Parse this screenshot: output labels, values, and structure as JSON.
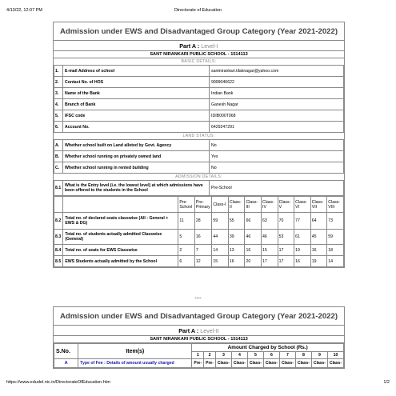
{
  "browser": {
    "datetime": "4/13/22, 12:07 PM",
    "page_title": "Directorate of Education",
    "url": "https://www.edudel.nic.in/DirectorateOfEducation.htm",
    "page_num": "1/2"
  },
  "form1": {
    "title": "Admission under EWS and Disadvantaged Group Category (Year 2021-2022)",
    "part": "Part A :",
    "level": "Level-I",
    "school": "SANT NIRANKARI PUBLIC SCHOOL - 1514113",
    "basic_heading": "BASIC DETAILS:",
    "basic": [
      {
        "n": "1.",
        "q": "E-mail Address of school",
        "v": "santnirankari.tilaknagar@yahoo.com"
      },
      {
        "n": "2.",
        "q": "Contact No. of HOS",
        "v": "9999046622"
      },
      {
        "n": "3.",
        "q": "Name of the Bank",
        "v": "Indian Bank"
      },
      {
        "n": "4.",
        "q": "Branch of Bank",
        "v": "Ganesh Nagar"
      },
      {
        "n": "5.",
        "q": "IFSC code",
        "v": "IDIB000T068"
      },
      {
        "n": "6.",
        "q": "Account No.",
        "v": "6429247291"
      }
    ],
    "land_heading": "LAND STATUS:",
    "land": [
      {
        "n": "A.",
        "q": "Whether school built on Land alloted by Govt. Agency",
        "v": "No"
      },
      {
        "n": "B.",
        "q": "Whether school running on privately owned land",
        "v": "Yes"
      },
      {
        "n": "C.",
        "q": "Whether school running in rented building",
        "v": "No"
      }
    ],
    "adm_heading": "ADMISSION DETAILS:",
    "adm_81": {
      "n": "8.1",
      "q": "What is the Entry level (i.e. the lowest level) at which admissions have been offered to the students in the School",
      "v": "Pre-School"
    },
    "classes": [
      "Pre-School",
      "Pre-Primary",
      "Class-I",
      "Class-II",
      "Class-III",
      "Class-IV",
      "Class-V",
      "Class-VI",
      "Class-VII",
      "Class-VIII"
    ],
    "rows": [
      {
        "n": "8.2",
        "q": "Total no. of declared seats classwise (All : General + EWS & DG)",
        "vals": [
          "11",
          "28",
          "59",
          "55",
          "66",
          "63",
          "70",
          "77",
          "64",
          "73"
        ]
      },
      {
        "n": "8.3",
        "q": "Total no. of students actually admitted Classwise (General)",
        "vals": [
          "5",
          "16",
          "44",
          "39",
          "46",
          "46",
          "53",
          "61",
          "45",
          "59"
        ]
      },
      {
        "n": "8.4",
        "q": "Total no. of seats for EWS Classwise",
        "vals": [
          "2",
          "7",
          "14",
          "13",
          "16",
          "15",
          "17",
          "19",
          "16",
          "18"
        ]
      },
      {
        "n": "8.5",
        "q": "EWS Students actually admitted by the School",
        "vals": [
          "6",
          "12",
          "15",
          "16",
          "20",
          "17",
          "17",
          "16",
          "19",
          "14"
        ]
      }
    ]
  },
  "separator": "----",
  "form2": {
    "title": "Admission under EWS and Disadvantaged Group Category (Year 2021-2022)",
    "part": "Part A :",
    "level": "Level-II",
    "school": "SANT NIRANKARI PUBLIC SCHOOL - 1514113",
    "sno_header": "S.No.",
    "items_header": "Item(s)",
    "amount_header": "Amount Charged by School (Rs.)",
    "col_numbers": [
      "1",
      "2",
      "3",
      "4",
      "5",
      "6",
      "7",
      "8",
      "9",
      "10"
    ],
    "rowA": {
      "n": "A",
      "q": "Type of Fee : Details of amount usually charged",
      "vals": [
        "Pre-",
        "Pre-",
        "Class-",
        "Class-",
        "Class-",
        "Class-",
        "Class-",
        "Class-",
        "Class-",
        "Class-"
      ]
    }
  }
}
